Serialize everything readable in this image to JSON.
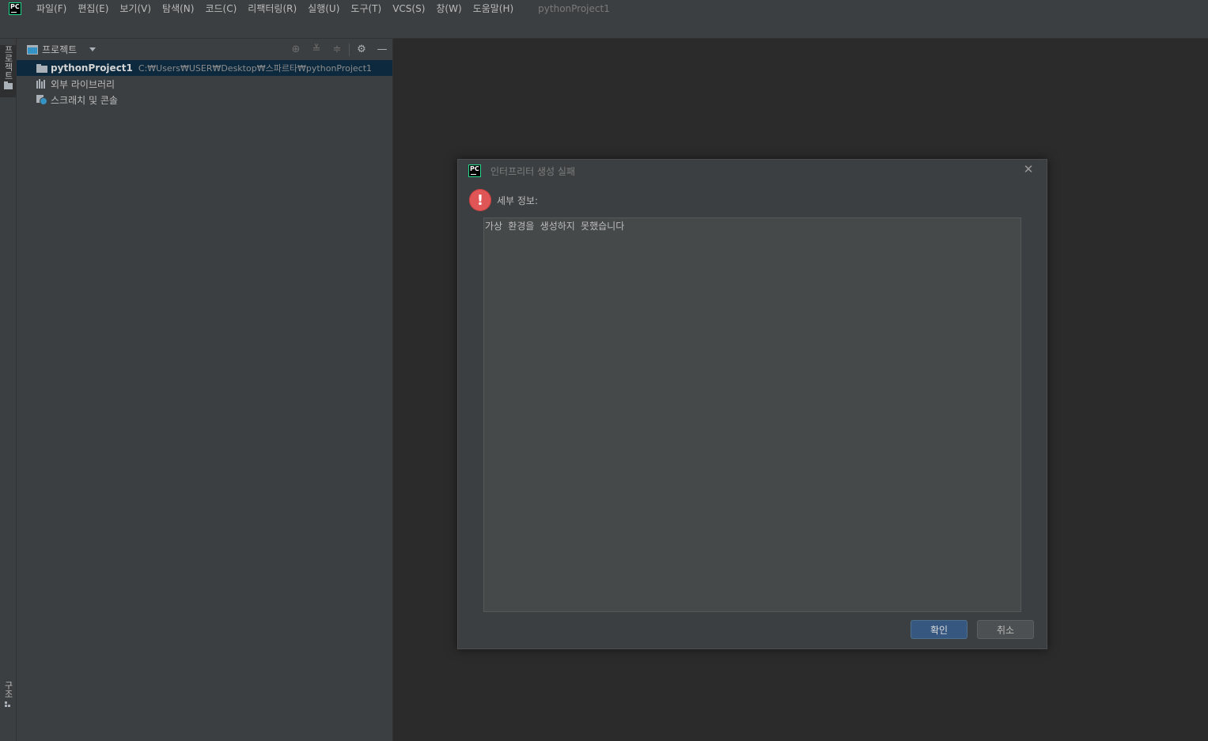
{
  "app": {
    "logo_text": "PC",
    "window_title": "pythonProject1"
  },
  "menu": [
    {
      "label": "파일(F)"
    },
    {
      "label": "편집(E)"
    },
    {
      "label": "보기(V)"
    },
    {
      "label": "탐색(N)"
    },
    {
      "label": "코드(C)"
    },
    {
      "label": "리팩터링(R)"
    },
    {
      "label": "실행(U)"
    },
    {
      "label": "도구(T)"
    },
    {
      "label": "VCS(S)"
    },
    {
      "label": "창(W)"
    },
    {
      "label": "도움말(H)"
    }
  ],
  "left_strip": {
    "project_label": "프로젝트",
    "structure_label": "구조"
  },
  "project_panel": {
    "title": "프로젝트",
    "icons": [
      "locate-icon",
      "expand-all-icon",
      "collapse-all-icon",
      "gear-icon",
      "minimize-icon"
    ],
    "tree": [
      {
        "name": "pythonProject1",
        "path": "C:₩Users₩USER₩Desktop₩스파르타₩pythonProject1",
        "icon": "folder-icon",
        "selected": true
      },
      {
        "name": "외부 라이브러리",
        "icon": "library-icon"
      },
      {
        "name": "스크래치 및 콘솔",
        "icon": "scratch-icon"
      }
    ]
  },
  "dialog": {
    "logo_text": "PC",
    "title": "인터프리터 생성 실패",
    "heading": "세부 정보:",
    "message": "가상 환경을 생성하지 못했습니다",
    "ok_label": "확인",
    "cancel_label": "취소"
  },
  "colors": {
    "accent_primary": "#365880",
    "error": "#e05555",
    "selection": "#0d293e"
  }
}
